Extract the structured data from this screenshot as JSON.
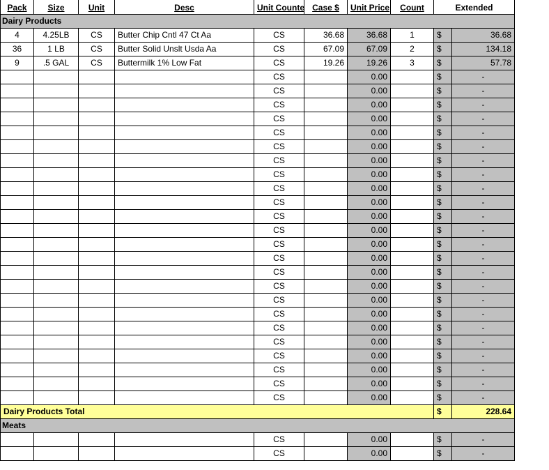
{
  "headers": {
    "pack": "Pack",
    "size": "Size",
    "unit": "Unit",
    "desc": "Desc",
    "unit_counted": "Unit Counted",
    "case_s": "Case $",
    "unit_price": "Unit Price",
    "count": "Count",
    "extended": "Extended"
  },
  "sections": [
    {
      "title": "Dairy Products",
      "rows": [
        {
          "pack": "4",
          "size": "4.25LB",
          "unit": "CS",
          "desc": "Butter Chip Cntl 47 Ct Aa",
          "unit_counted": "CS",
          "case_s": "36.68",
          "unit_price": "36.68",
          "count": "1",
          "ext_sym": "$",
          "ext_val": "36.68"
        },
        {
          "pack": "36",
          "size": "1 LB",
          "unit": "CS",
          "desc": "Butter Solid Unslt Usda Aa",
          "unit_counted": "CS",
          "case_s": "67.09",
          "unit_price": "67.09",
          "count": "2",
          "ext_sym": "$",
          "ext_val": "134.18"
        },
        {
          "pack": "9",
          "size": ".5 GAL",
          "unit": "CS",
          "desc": "Buttermilk 1% Low Fat",
          "unit_counted": "CS",
          "case_s": "19.26",
          "unit_price": "19.26",
          "count": "3",
          "ext_sym": "$",
          "ext_val": "57.78"
        },
        {
          "pack": "",
          "size": "",
          "unit": "",
          "desc": "",
          "unit_counted": "CS",
          "case_s": "",
          "unit_price": "0.00",
          "count": "",
          "ext_sym": "$",
          "ext_val": "-"
        },
        {
          "pack": "",
          "size": "",
          "unit": "",
          "desc": "",
          "unit_counted": "CS",
          "case_s": "",
          "unit_price": "0.00",
          "count": "",
          "ext_sym": "$",
          "ext_val": "-"
        },
        {
          "pack": "",
          "size": "",
          "unit": "",
          "desc": "",
          "unit_counted": "CS",
          "case_s": "",
          "unit_price": "0.00",
          "count": "",
          "ext_sym": "$",
          "ext_val": "-"
        },
        {
          "pack": "",
          "size": "",
          "unit": "",
          "desc": "",
          "unit_counted": "CS",
          "case_s": "",
          "unit_price": "0.00",
          "count": "",
          "ext_sym": "$",
          "ext_val": "-"
        },
        {
          "pack": "",
          "size": "",
          "unit": "",
          "desc": "",
          "unit_counted": "CS",
          "case_s": "",
          "unit_price": "0.00",
          "count": "",
          "ext_sym": "$",
          "ext_val": "-"
        },
        {
          "pack": "",
          "size": "",
          "unit": "",
          "desc": "",
          "unit_counted": "CS",
          "case_s": "",
          "unit_price": "0.00",
          "count": "",
          "ext_sym": "$",
          "ext_val": "-"
        },
        {
          "pack": "",
          "size": "",
          "unit": "",
          "desc": "",
          "unit_counted": "CS",
          "case_s": "",
          "unit_price": "0.00",
          "count": "",
          "ext_sym": "$",
          "ext_val": "-"
        },
        {
          "pack": "",
          "size": "",
          "unit": "",
          "desc": "",
          "unit_counted": "CS",
          "case_s": "",
          "unit_price": "0.00",
          "count": "",
          "ext_sym": "$",
          "ext_val": "-"
        },
        {
          "pack": "",
          "size": "",
          "unit": "",
          "desc": "",
          "unit_counted": "CS",
          "case_s": "",
          "unit_price": "0.00",
          "count": "",
          "ext_sym": "$",
          "ext_val": "-"
        },
        {
          "pack": "",
          "size": "",
          "unit": "",
          "desc": "",
          "unit_counted": "CS",
          "case_s": "",
          "unit_price": "0.00",
          "count": "",
          "ext_sym": "$",
          "ext_val": "-"
        },
        {
          "pack": "",
          "size": "",
          "unit": "",
          "desc": "",
          "unit_counted": "CS",
          "case_s": "",
          "unit_price": "0.00",
          "count": "",
          "ext_sym": "$",
          "ext_val": "-"
        },
        {
          "pack": "",
          "size": "",
          "unit": "",
          "desc": "",
          "unit_counted": "CS",
          "case_s": "",
          "unit_price": "0.00",
          "count": "",
          "ext_sym": "$",
          "ext_val": "-"
        },
        {
          "pack": "",
          "size": "",
          "unit": "",
          "desc": "",
          "unit_counted": "CS",
          "case_s": "",
          "unit_price": "0.00",
          "count": "",
          "ext_sym": "$",
          "ext_val": "-"
        },
        {
          "pack": "",
          "size": "",
          "unit": "",
          "desc": "",
          "unit_counted": "CS",
          "case_s": "",
          "unit_price": "0.00",
          "count": "",
          "ext_sym": "$",
          "ext_val": "-"
        },
        {
          "pack": "",
          "size": "",
          "unit": "",
          "desc": "",
          "unit_counted": "CS",
          "case_s": "",
          "unit_price": "0.00",
          "count": "",
          "ext_sym": "$",
          "ext_val": "-"
        },
        {
          "pack": "",
          "size": "",
          "unit": "",
          "desc": "",
          "unit_counted": "CS",
          "case_s": "",
          "unit_price": "0.00",
          "count": "",
          "ext_sym": "$",
          "ext_val": "-"
        },
        {
          "pack": "",
          "size": "",
          "unit": "",
          "desc": "",
          "unit_counted": "CS",
          "case_s": "",
          "unit_price": "0.00",
          "count": "",
          "ext_sym": "$",
          "ext_val": "-"
        },
        {
          "pack": "",
          "size": "",
          "unit": "",
          "desc": "",
          "unit_counted": "CS",
          "case_s": "",
          "unit_price": "0.00",
          "count": "",
          "ext_sym": "$",
          "ext_val": "-"
        },
        {
          "pack": "",
          "size": "",
          "unit": "",
          "desc": "",
          "unit_counted": "CS",
          "case_s": "",
          "unit_price": "0.00",
          "count": "",
          "ext_sym": "$",
          "ext_val": "-"
        },
        {
          "pack": "",
          "size": "",
          "unit": "",
          "desc": "",
          "unit_counted": "CS",
          "case_s": "",
          "unit_price": "0.00",
          "count": "",
          "ext_sym": "$",
          "ext_val": "-"
        },
        {
          "pack": "",
          "size": "",
          "unit": "",
          "desc": "",
          "unit_counted": "CS",
          "case_s": "",
          "unit_price": "0.00",
          "count": "",
          "ext_sym": "$",
          "ext_val": "-"
        },
        {
          "pack": "",
          "size": "",
          "unit": "",
          "desc": "",
          "unit_counted": "CS",
          "case_s": "",
          "unit_price": "0.00",
          "count": "",
          "ext_sym": "$",
          "ext_val": "-"
        },
        {
          "pack": "",
          "size": "",
          "unit": "",
          "desc": "",
          "unit_counted": "CS",
          "case_s": "",
          "unit_price": "0.00",
          "count": "",
          "ext_sym": "$",
          "ext_val": "-"
        },
        {
          "pack": "",
          "size": "",
          "unit": "",
          "desc": "",
          "unit_counted": "CS",
          "case_s": "",
          "unit_price": "0.00",
          "count": "",
          "ext_sym": "$",
          "ext_val": "-"
        }
      ],
      "total_label": "Dairy Products Total",
      "total_sym": "$",
      "total_val": "228.64"
    },
    {
      "title": "Meats",
      "rows": [
        {
          "pack": "",
          "size": "",
          "unit": "",
          "desc": "",
          "unit_counted": "CS",
          "case_s": "",
          "unit_price": "0.00",
          "count": "",
          "ext_sym": "$",
          "ext_val": "-"
        },
        {
          "pack": "",
          "size": "",
          "unit": "",
          "desc": "",
          "unit_counted": "CS",
          "case_s": "",
          "unit_price": "0.00",
          "count": "",
          "ext_sym": "$",
          "ext_val": "-"
        }
      ]
    }
  ]
}
